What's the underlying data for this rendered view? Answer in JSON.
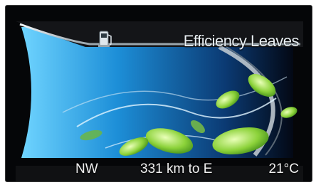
{
  "header": {
    "title": "Efficiency Leaves",
    "icon": "fuel-pump-icon"
  },
  "footer": {
    "compass": "NW",
    "distance": "331 km to E",
    "temperature": "21°C"
  },
  "colors": {
    "accent_blue": "#1e88c8",
    "leaf_green": "#9fd64a",
    "text": "#f0f0f0"
  }
}
